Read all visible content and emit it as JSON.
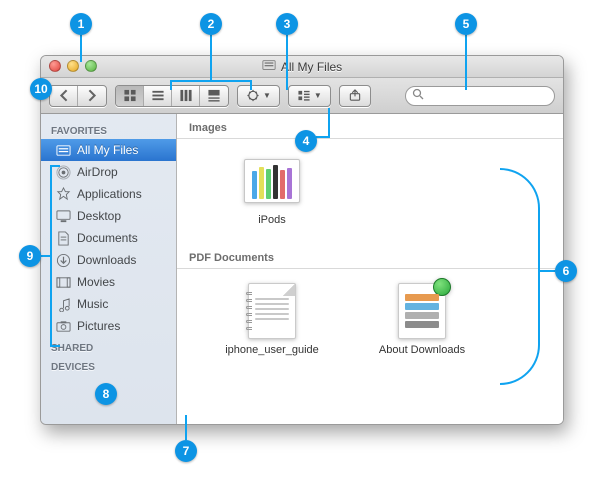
{
  "window": {
    "title": "All My Files"
  },
  "sidebar": {
    "sections": [
      {
        "label": "FAVORITES",
        "items": [
          {
            "label": "All My Files",
            "icon": "all-my-files"
          },
          {
            "label": "AirDrop",
            "icon": "airdrop"
          },
          {
            "label": "Applications",
            "icon": "applications"
          },
          {
            "label": "Desktop",
            "icon": "desktop"
          },
          {
            "label": "Documents",
            "icon": "documents"
          },
          {
            "label": "Downloads",
            "icon": "downloads"
          },
          {
            "label": "Movies",
            "icon": "movies"
          },
          {
            "label": "Music",
            "icon": "music"
          },
          {
            "label": "Pictures",
            "icon": "pictures"
          }
        ]
      },
      {
        "label": "SHARED",
        "items": []
      },
      {
        "label": "DEVICES",
        "items": []
      }
    ]
  },
  "content": {
    "sections": [
      {
        "header": "Images",
        "files": [
          {
            "label": "iPods",
            "kind": "image"
          }
        ]
      },
      {
        "header": "PDF Documents",
        "files": [
          {
            "label": "iphone_user_guide",
            "kind": "pdf-manual"
          },
          {
            "label": "About Downloads",
            "kind": "pdf-download"
          }
        ]
      }
    ]
  },
  "callouts": {
    "1": "1",
    "2": "2",
    "3": "3",
    "4": "4",
    "5": "5",
    "6": "6",
    "7": "7",
    "8": "8",
    "9": "9",
    "10": "10"
  },
  "colors": {
    "callout": "#0d94e4",
    "selection": "#2a74cf"
  }
}
